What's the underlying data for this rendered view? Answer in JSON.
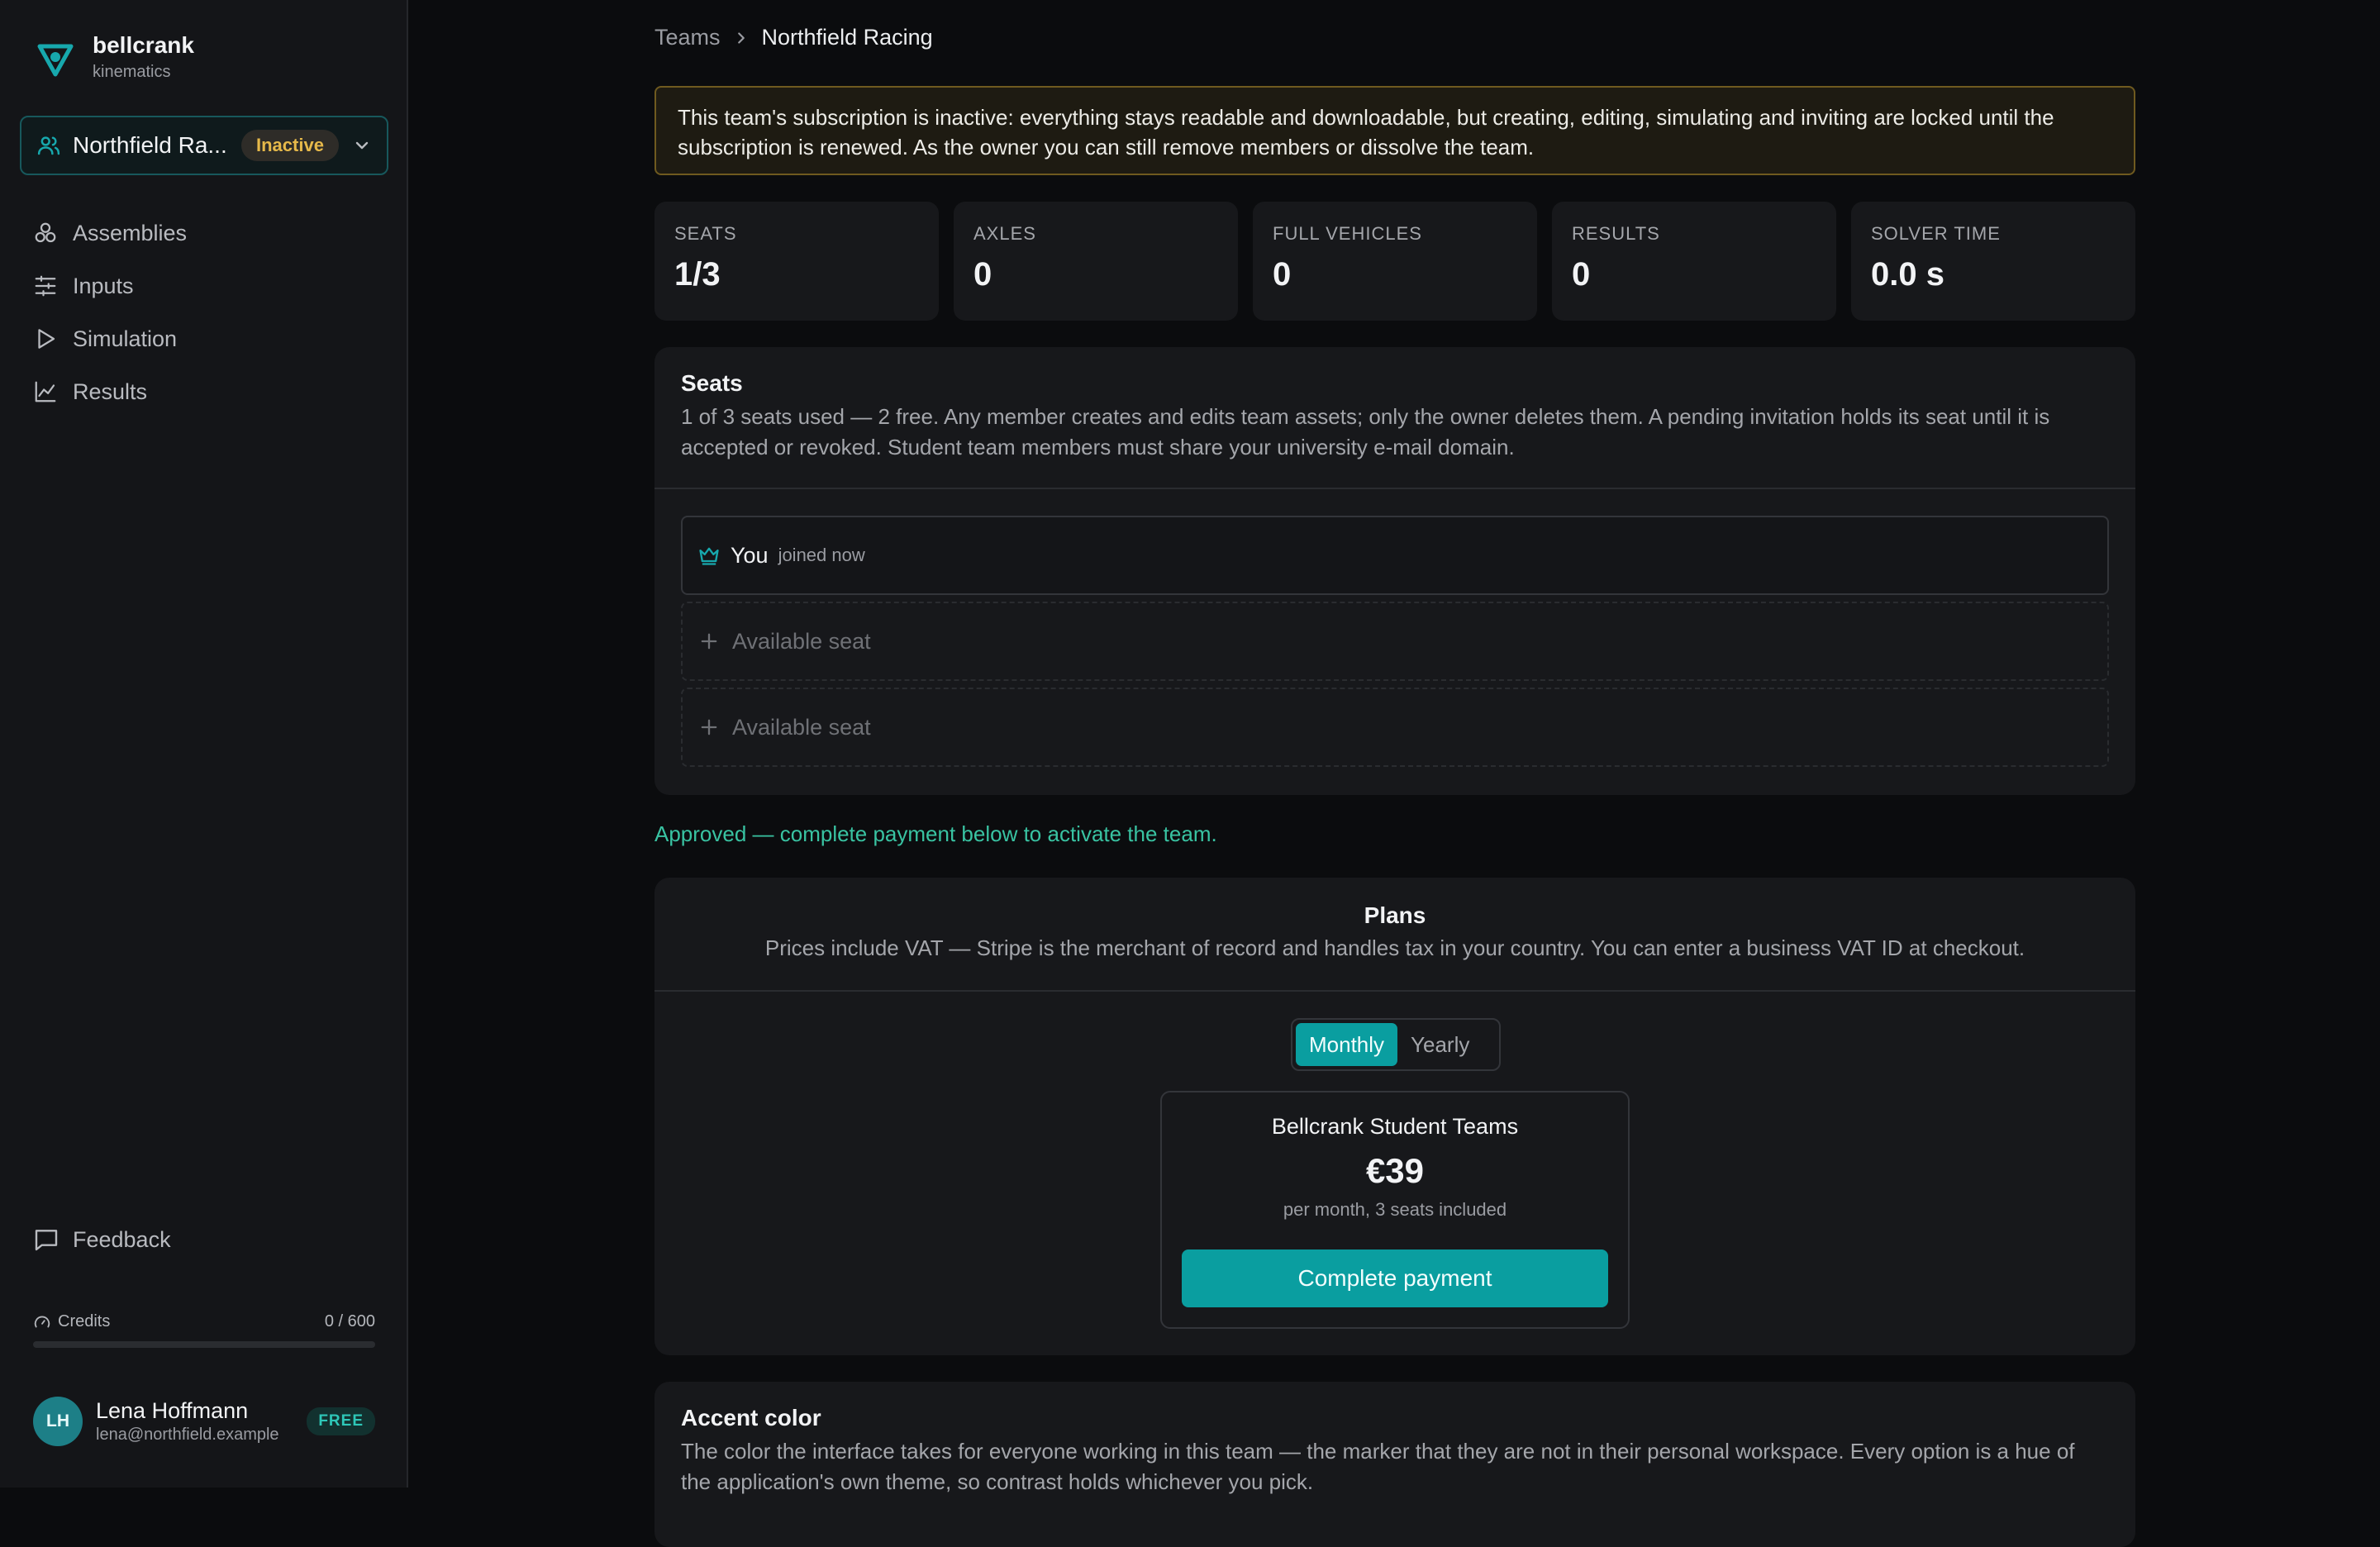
{
  "sidebar": {
    "brand": {
      "name": "bellcrank",
      "subtitle": "kinematics"
    },
    "team_switcher": {
      "name": "Northfield Ra...",
      "status": "Inactive"
    },
    "nav": [
      {
        "label": "Assemblies",
        "icon": "assemblies-icon"
      },
      {
        "label": "Inputs",
        "icon": "sliders-icon"
      },
      {
        "label": "Simulation",
        "icon": "play-icon"
      },
      {
        "label": "Results",
        "icon": "chart-line-icon"
      }
    ],
    "feedback": {
      "label": "Feedback"
    },
    "credits": {
      "label": "Credits",
      "value": "0 / 600",
      "used_fraction": 0
    },
    "user": {
      "initials": "LH",
      "name": "Lena Hoffmann",
      "email": "lena@northfield.example",
      "plan": "FREE"
    }
  },
  "breadcrumb": {
    "parent": "Teams",
    "current": "Northfield Racing"
  },
  "warning": "This team's subscription is inactive: everything stays readable and downloadable, but creating, editing, simulating and inviting are locked until the subscription is renewed. As the owner you can still remove members or dissolve the team.",
  "stats": [
    {
      "label": "SEATS",
      "value": "1/3"
    },
    {
      "label": "AXLES",
      "value": "0"
    },
    {
      "label": "FULL VEHICLES",
      "value": "0"
    },
    {
      "label": "RESULTS",
      "value": "0"
    },
    {
      "label": "SOLVER TIME",
      "value": "0.0 s"
    }
  ],
  "seats": {
    "title": "Seats",
    "description": "1 of 3 seats used — 2 free. Any member creates and edits team assets; only the owner deletes them. A pending invitation holds its seat until it is accepted or revoked. Student team members must share your university e-mail domain.",
    "members": [
      {
        "name": "You",
        "joined": "joined now"
      }
    ],
    "available_label": "Available seat"
  },
  "approved_message": "Approved — complete payment below to activate the team.",
  "plans": {
    "title": "Plans",
    "description": "Prices include VAT — Stripe is the merchant of record and handles tax in your country. You can enter a business VAT ID at checkout.",
    "billing_options": [
      "Monthly",
      "Yearly"
    ],
    "selected_billing": "Monthly",
    "plan": {
      "name": "Bellcrank Student Teams",
      "price": "€39",
      "note": "per month, 3 seats included",
      "cta": "Complete payment"
    }
  },
  "accent": {
    "title": "Accent color",
    "description": "The color the interface takes for everyone working in this team — the marker that they are not in their personal workspace. Every option is a hue of the application's own theme, so contrast holds whichever you pick."
  },
  "colors": {
    "accent": "#0a9ea0",
    "warning": "#e6b94a",
    "success": "#39c3a2"
  }
}
